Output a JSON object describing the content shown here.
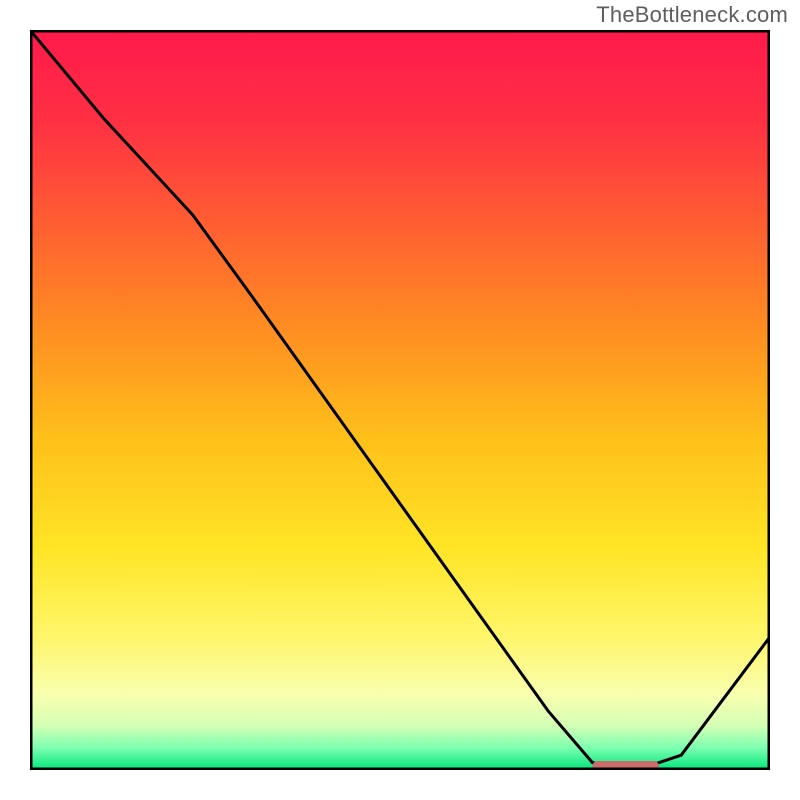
{
  "watermark": "TheBottleneck.com",
  "chart_data": {
    "type": "line",
    "title": "",
    "xlabel": "",
    "ylabel": "",
    "xlim": [
      0,
      100
    ],
    "ylim": [
      0,
      100
    ],
    "grid": false,
    "series": [
      {
        "name": "bottleneck-curve",
        "x": [
          0,
          10,
          22,
          30,
          40,
          50,
          60,
          70,
          76,
          82,
          88,
          100
        ],
        "y": [
          100,
          88,
          75,
          64,
          50,
          36,
          22,
          8,
          1,
          0,
          2,
          18
        ]
      }
    ],
    "gradient_stops": [
      {
        "offset": 0.0,
        "color": "#ff1a4b"
      },
      {
        "offset": 0.12,
        "color": "#ff2f44"
      },
      {
        "offset": 0.25,
        "color": "#ff5a33"
      },
      {
        "offset": 0.4,
        "color": "#ff8c22"
      },
      {
        "offset": 0.55,
        "color": "#ffbf1a"
      },
      {
        "offset": 0.7,
        "color": "#ffe526"
      },
      {
        "offset": 0.82,
        "color": "#fff66a"
      },
      {
        "offset": 0.9,
        "color": "#f8ffb0"
      },
      {
        "offset": 0.94,
        "color": "#d4ffb5"
      },
      {
        "offset": 0.97,
        "color": "#7dffb0"
      },
      {
        "offset": 1.0,
        "color": "#00e57a"
      }
    ],
    "marker": {
      "name": "optimal-range",
      "x_start": 76,
      "x_end": 85,
      "y": 0,
      "color": "#cc6b6b"
    },
    "frame": {
      "stroke": "#000000",
      "stroke_width": 5
    },
    "curve_style": {
      "stroke": "#000000",
      "stroke_width": 3
    }
  }
}
